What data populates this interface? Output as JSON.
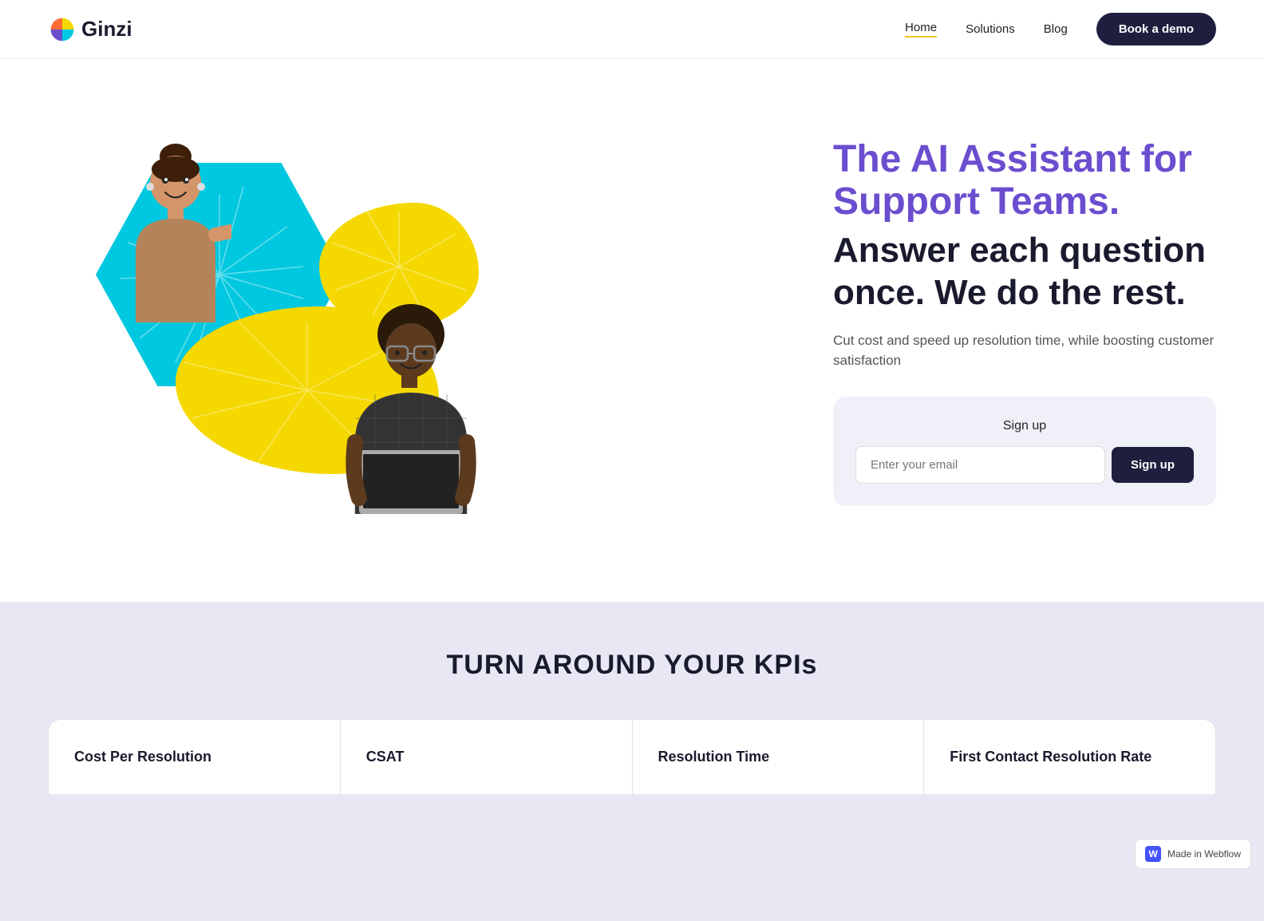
{
  "logo": {
    "text": "Ginzi"
  },
  "nav": {
    "links": [
      {
        "label": "Home",
        "active": true
      },
      {
        "label": "Solutions",
        "active": false
      },
      {
        "label": "Blog",
        "active": false
      }
    ],
    "cta_label": "Book a demo"
  },
  "hero": {
    "title_purple": "The AI Assistant for Support Teams.",
    "title_dark": "Answer each question once. We do the rest.",
    "subtitle": "Cut cost and speed up resolution time, while boosting customer satisfaction",
    "signup": {
      "label": "Sign up",
      "input_placeholder": "Enter your email",
      "button_label": "Sign up"
    }
  },
  "kpi": {
    "section_title": "TURN AROUND YOUR KPIs",
    "cards": [
      {
        "title": "Cost Per Resolution"
      },
      {
        "title": "CSAT"
      },
      {
        "title": "Resolution Time"
      },
      {
        "title": "First Contact Resolution Rate"
      }
    ]
  },
  "webflow_badge": {
    "label": "Made in Webflow"
  },
  "colors": {
    "purple": "#6b4ecf",
    "dark_navy": "#1e1e3f",
    "teal": "#00c8e0",
    "yellow": "#f5d800",
    "kpi_bg": "#e8e8f4"
  }
}
